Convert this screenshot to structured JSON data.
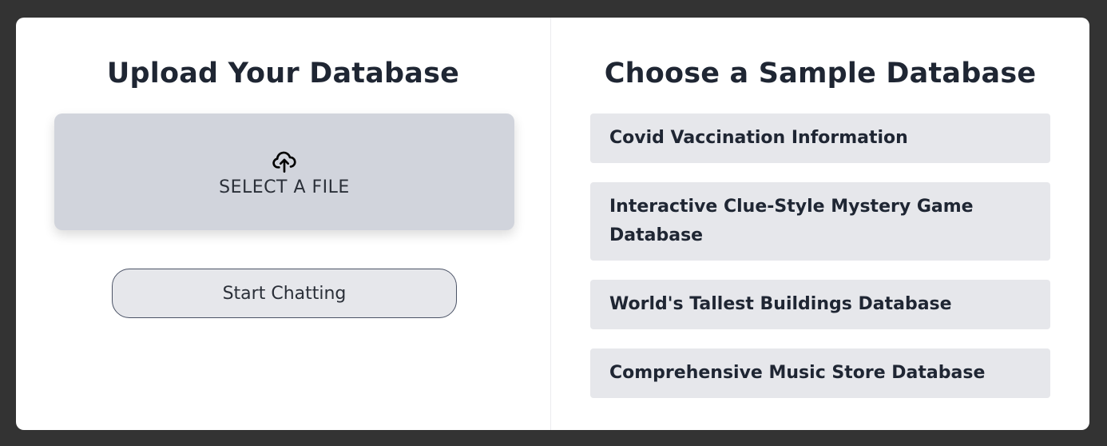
{
  "upload": {
    "title": "Upload Your Database",
    "dropzone_label": "SELECT A FILE",
    "dropzone_icon": "cloud-upload-icon",
    "start_button_label": "Start Chatting"
  },
  "samples": {
    "title": "Choose a Sample Database",
    "items": [
      {
        "label": "Covid Vaccination Information"
      },
      {
        "label": "Interactive Clue-Style Mystery Game Database"
      },
      {
        "label": "World's Tallest Buildings Database"
      },
      {
        "label": "Comprehensive Music Store Database"
      }
    ]
  },
  "colors": {
    "background": "#333333",
    "card": "#ffffff",
    "dropzone": "#d1d4dc",
    "item": "#e6e7eb",
    "text": "#1f2633"
  }
}
